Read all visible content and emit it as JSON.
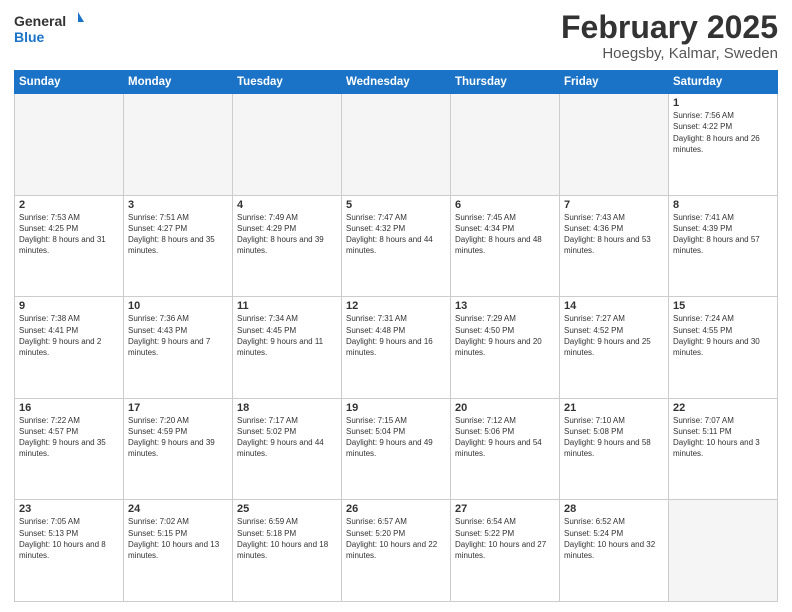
{
  "header": {
    "logo_line1": "General",
    "logo_line2": "Blue",
    "month": "February 2025",
    "location": "Hoegsby, Kalmar, Sweden"
  },
  "days_of_week": [
    "Sunday",
    "Monday",
    "Tuesday",
    "Wednesday",
    "Thursday",
    "Friday",
    "Saturday"
  ],
  "weeks": [
    [
      {
        "num": "",
        "info": ""
      },
      {
        "num": "",
        "info": ""
      },
      {
        "num": "",
        "info": ""
      },
      {
        "num": "",
        "info": ""
      },
      {
        "num": "",
        "info": ""
      },
      {
        "num": "",
        "info": ""
      },
      {
        "num": "1",
        "info": "Sunrise: 7:56 AM\nSunset: 4:22 PM\nDaylight: 8 hours and 26 minutes."
      }
    ],
    [
      {
        "num": "2",
        "info": "Sunrise: 7:53 AM\nSunset: 4:25 PM\nDaylight: 8 hours and 31 minutes."
      },
      {
        "num": "3",
        "info": "Sunrise: 7:51 AM\nSunset: 4:27 PM\nDaylight: 8 hours and 35 minutes."
      },
      {
        "num": "4",
        "info": "Sunrise: 7:49 AM\nSunset: 4:29 PM\nDaylight: 8 hours and 39 minutes."
      },
      {
        "num": "5",
        "info": "Sunrise: 7:47 AM\nSunset: 4:32 PM\nDaylight: 8 hours and 44 minutes."
      },
      {
        "num": "6",
        "info": "Sunrise: 7:45 AM\nSunset: 4:34 PM\nDaylight: 8 hours and 48 minutes."
      },
      {
        "num": "7",
        "info": "Sunrise: 7:43 AM\nSunset: 4:36 PM\nDaylight: 8 hours and 53 minutes."
      },
      {
        "num": "8",
        "info": "Sunrise: 7:41 AM\nSunset: 4:39 PM\nDaylight: 8 hours and 57 minutes."
      }
    ],
    [
      {
        "num": "9",
        "info": "Sunrise: 7:38 AM\nSunset: 4:41 PM\nDaylight: 9 hours and 2 minutes."
      },
      {
        "num": "10",
        "info": "Sunrise: 7:36 AM\nSunset: 4:43 PM\nDaylight: 9 hours and 7 minutes."
      },
      {
        "num": "11",
        "info": "Sunrise: 7:34 AM\nSunset: 4:45 PM\nDaylight: 9 hours and 11 minutes."
      },
      {
        "num": "12",
        "info": "Sunrise: 7:31 AM\nSunset: 4:48 PM\nDaylight: 9 hours and 16 minutes."
      },
      {
        "num": "13",
        "info": "Sunrise: 7:29 AM\nSunset: 4:50 PM\nDaylight: 9 hours and 20 minutes."
      },
      {
        "num": "14",
        "info": "Sunrise: 7:27 AM\nSunset: 4:52 PM\nDaylight: 9 hours and 25 minutes."
      },
      {
        "num": "15",
        "info": "Sunrise: 7:24 AM\nSunset: 4:55 PM\nDaylight: 9 hours and 30 minutes."
      }
    ],
    [
      {
        "num": "16",
        "info": "Sunrise: 7:22 AM\nSunset: 4:57 PM\nDaylight: 9 hours and 35 minutes."
      },
      {
        "num": "17",
        "info": "Sunrise: 7:20 AM\nSunset: 4:59 PM\nDaylight: 9 hours and 39 minutes."
      },
      {
        "num": "18",
        "info": "Sunrise: 7:17 AM\nSunset: 5:02 PM\nDaylight: 9 hours and 44 minutes."
      },
      {
        "num": "19",
        "info": "Sunrise: 7:15 AM\nSunset: 5:04 PM\nDaylight: 9 hours and 49 minutes."
      },
      {
        "num": "20",
        "info": "Sunrise: 7:12 AM\nSunset: 5:06 PM\nDaylight: 9 hours and 54 minutes."
      },
      {
        "num": "21",
        "info": "Sunrise: 7:10 AM\nSunset: 5:08 PM\nDaylight: 9 hours and 58 minutes."
      },
      {
        "num": "22",
        "info": "Sunrise: 7:07 AM\nSunset: 5:11 PM\nDaylight: 10 hours and 3 minutes."
      }
    ],
    [
      {
        "num": "23",
        "info": "Sunrise: 7:05 AM\nSunset: 5:13 PM\nDaylight: 10 hours and 8 minutes."
      },
      {
        "num": "24",
        "info": "Sunrise: 7:02 AM\nSunset: 5:15 PM\nDaylight: 10 hours and 13 minutes."
      },
      {
        "num": "25",
        "info": "Sunrise: 6:59 AM\nSunset: 5:18 PM\nDaylight: 10 hours and 18 minutes."
      },
      {
        "num": "26",
        "info": "Sunrise: 6:57 AM\nSunset: 5:20 PM\nDaylight: 10 hours and 22 minutes."
      },
      {
        "num": "27",
        "info": "Sunrise: 6:54 AM\nSunset: 5:22 PM\nDaylight: 10 hours and 27 minutes."
      },
      {
        "num": "28",
        "info": "Sunrise: 6:52 AM\nSunset: 5:24 PM\nDaylight: 10 hours and 32 minutes."
      },
      {
        "num": "",
        "info": ""
      }
    ]
  ]
}
